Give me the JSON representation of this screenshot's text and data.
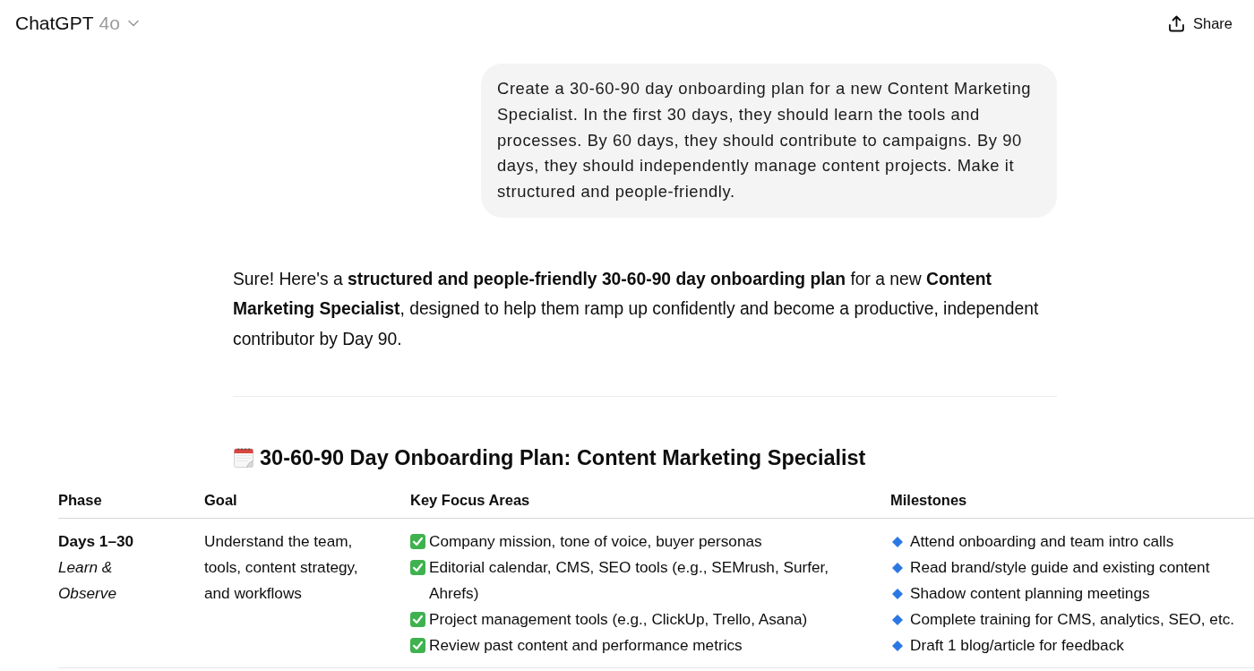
{
  "header": {
    "title": "ChatGPT",
    "model": "4o",
    "share_button": "Share"
  },
  "user_message": "Create a 30-60-90 day onboarding plan for a new Content Marketing Specialist. In the first 30 days, they should learn the tools and processes. By 60 days, they should contribute to campaigns. By 90 days, they should independently manage content projects. Make it structured and people-friendly.",
  "assistant_message": {
    "intro": "Sure! Here's a **structured and people-friendly 30-60-90 day onboarding plan** for a new **Content Marketing Specialist**, designed to help them ramp up confidently and become a productive, independent contributor by Day 90.",
    "heading": "30-60-90 Day Onboarding Plan: Content Marketing Specialist",
    "table": {
      "columns": [
        "Phase",
        "Goal",
        "Key Focus Areas",
        "Milestones"
      ],
      "rows": [
        {
          "phase": "Days 1–30",
          "phase_theme": "Learn & Observe",
          "goal": "Understand the team, tools, content strategy, and workflows",
          "focus_areas": [
            "Company mission, tone of voice, buyer personas",
            "Editorial calendar, CMS, SEO tools (e.g., SEMrush, Surfer, Ahrefs)",
            "Project management tools (e.g., ClickUp, Trello, Asana)",
            "Review past content and performance metrics"
          ],
          "milestones": [
            "Attend onboarding and team intro calls",
            "Read brand/style guide and existing content",
            "Shadow content planning meetings",
            "Complete training for CMS, analytics, SEO, etc.",
            "Draft 1 blog/article for feedback"
          ]
        }
      ]
    }
  }
}
